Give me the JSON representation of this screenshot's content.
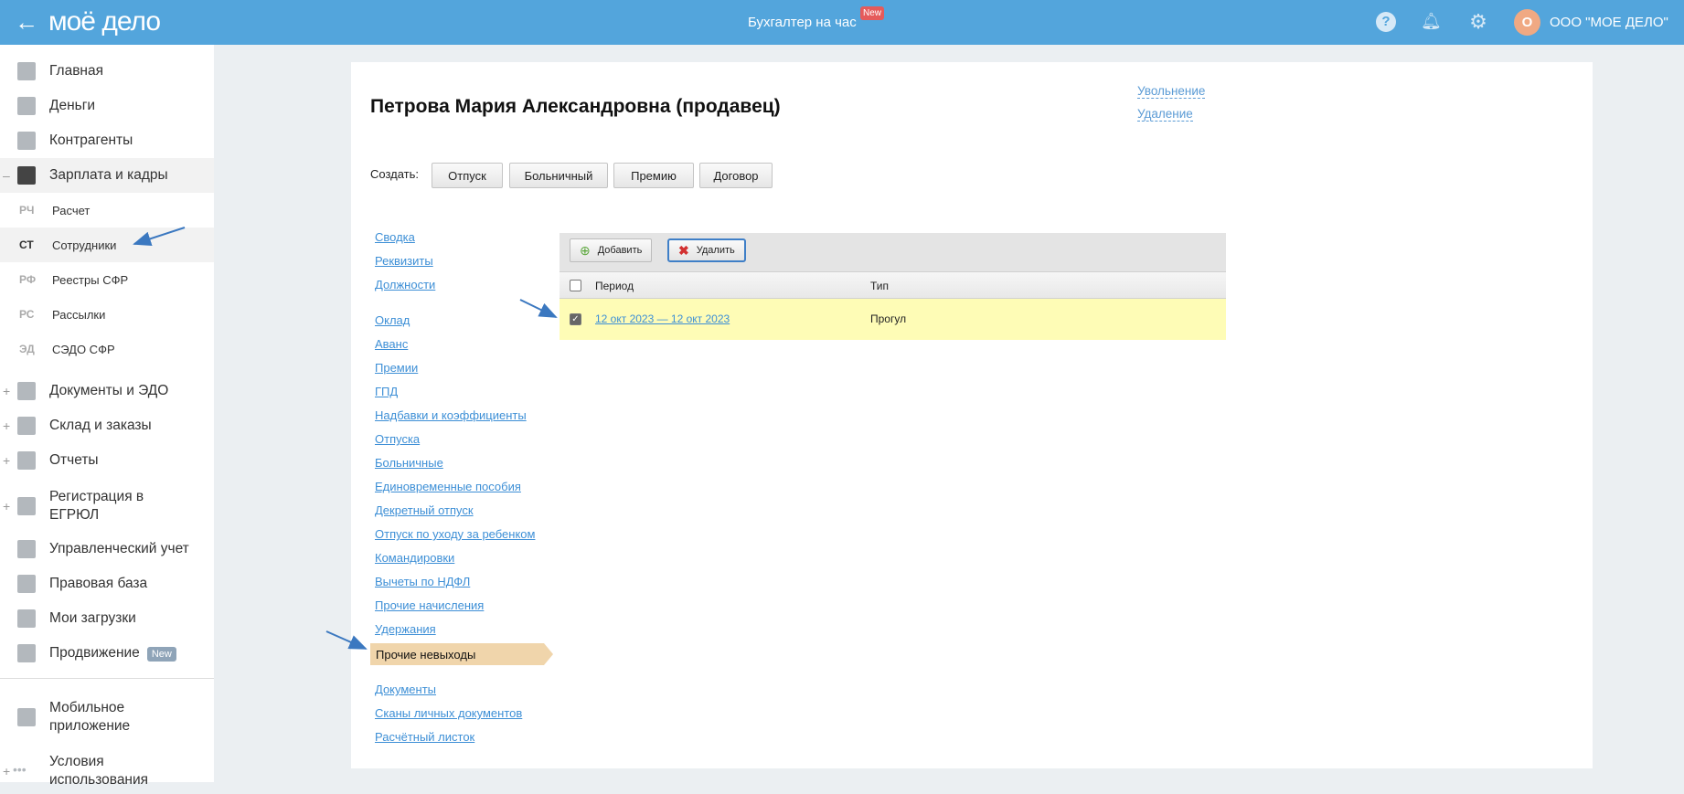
{
  "header": {
    "logo": "моё дело",
    "center_link": "Бухгалтер на час",
    "new_badge": "New",
    "avatar_letter": "О",
    "org": "ООО \"МОЕ ДЕЛО\""
  },
  "sidebar": {
    "items": [
      {
        "label": "Главная"
      },
      {
        "label": "Деньги"
      },
      {
        "label": "Контрагенты"
      },
      {
        "label": "Зарплата и кадры",
        "prefix": "–"
      },
      {
        "label": "Документы и ЭДО",
        "prefix": "+"
      },
      {
        "label": "Склад и заказы",
        "prefix": "+"
      },
      {
        "label": "Отчеты",
        "prefix": "+"
      },
      {
        "label": "Регистрация в ЕГРЮЛ",
        "prefix": "+"
      },
      {
        "label": "Управленческий учет"
      },
      {
        "label": "Правовая база"
      },
      {
        "label": "Мои загрузки"
      },
      {
        "label": "Продвижение",
        "badge": "New"
      },
      {
        "label": "Мобильное приложение"
      },
      {
        "label": "Условия использования",
        "prefix": "+"
      }
    ],
    "sub": [
      {
        "abbr": "РЧ",
        "label": "Расчет"
      },
      {
        "abbr": "СТ",
        "label": "Сотрудники"
      },
      {
        "abbr": "РФ",
        "label": "Реестры СФР"
      },
      {
        "abbr": "РС",
        "label": "Рассылки"
      },
      {
        "abbr": "ЭД",
        "label": "СЭДО СФР"
      }
    ]
  },
  "employee": {
    "title": "Петрова Мария Александровна (продавец)",
    "dismiss": "Увольнение",
    "delete": "Удаление",
    "create_label": "Создать:",
    "create_buttons": [
      "Отпуск",
      "Больничный",
      "Премию",
      "Договор"
    ]
  },
  "nav": [
    "Сводка",
    "Реквизиты",
    "Должности",
    "Оклад",
    "Аванс",
    "Премии",
    "ГПД",
    "Надбавки и коэффициенты",
    "Отпуска",
    "Больничные",
    "Единовременные пособия",
    "Декретный отпуск",
    "Отпуск по уходу за ребенком",
    "Командировки",
    "Вычеты по НДФЛ",
    "Прочие начисления",
    "Удержания",
    "Прочие невыходы",
    "Документы",
    "Сканы личных документов",
    "Расчётный листок"
  ],
  "table": {
    "add": "Добавить",
    "remove": "Удалить",
    "columns": [
      "Период",
      "Тип"
    ],
    "rows": [
      {
        "period": "12 окт 2023 — 12 окт 2023",
        "type": "Прогул",
        "checked": true
      }
    ]
  }
}
